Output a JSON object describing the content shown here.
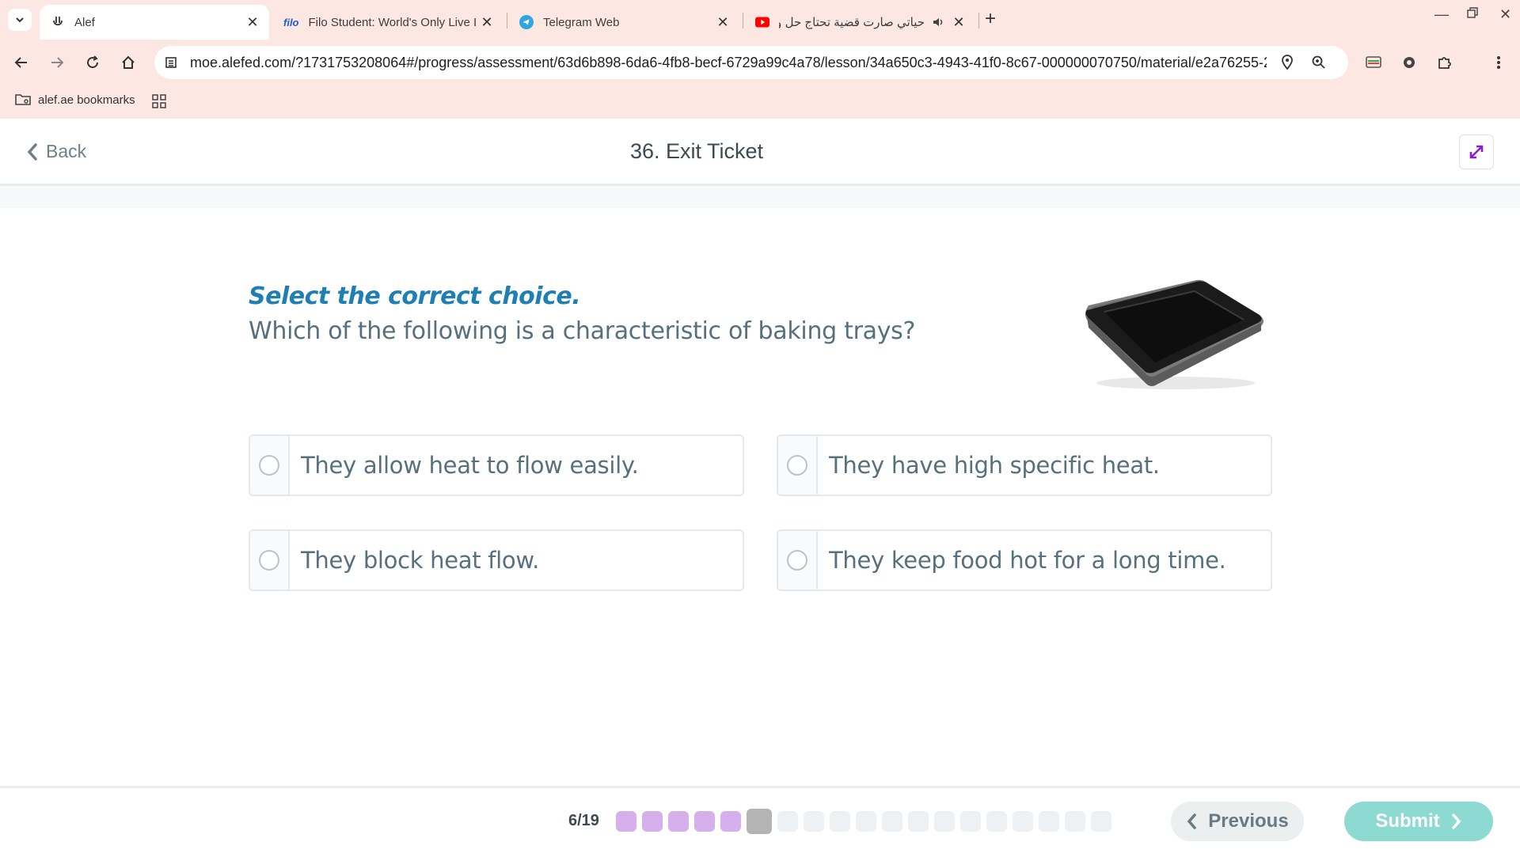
{
  "browser": {
    "tabs": [
      {
        "title": "Alef",
        "favicon": "alef-icon",
        "active": true
      },
      {
        "title": "Filo Student: World's Only Live I",
        "favicon_text": "filo",
        "active": false
      },
      {
        "title": "Telegram Web",
        "favicon": "telegram-icon",
        "active": false
      },
      {
        "title": "حياتي صارت قضية تحتاج حل و",
        "favicon": "youtube-icon",
        "active": false,
        "audio": true
      }
    ],
    "url": "moe.alefed.com/?1731753208064#/progress/assessment/63d6b898-6da6-4fb8-becf-6729a99c4a78/lesson/34a650c3-4943-41f0-8c67-000000070750/material/e2a76255-2...",
    "bookmarks": [
      {
        "label": "alef.ae bookmarks",
        "icon": "bookmark-folder-icon"
      }
    ]
  },
  "header": {
    "back_label": "Back",
    "title": "36. Exit Ticket"
  },
  "question": {
    "instruction": "Select the correct choice.",
    "text": "Which of the following is a characteristic of baking trays?",
    "image": "baking-tray-image",
    "options": [
      {
        "text": "They allow heat to flow easily."
      },
      {
        "text": "They have high specific heat."
      },
      {
        "text": "They block heat flow."
      },
      {
        "text": "They keep food hot for a long time."
      }
    ]
  },
  "footer": {
    "progress_label": "6/19",
    "current": 6,
    "total": 19,
    "previous_label": "Previous",
    "submit_label": "Submit"
  },
  "colors": {
    "chrome_bg": "#fde7e2",
    "instruction": "#1d7fb3",
    "question_text": "#56707d",
    "answered_dot": "#d6b0ec",
    "current_dot": "#b4b4b4",
    "submit_bg": "#8ddad3",
    "expand_icon": "#8a1fc9"
  }
}
